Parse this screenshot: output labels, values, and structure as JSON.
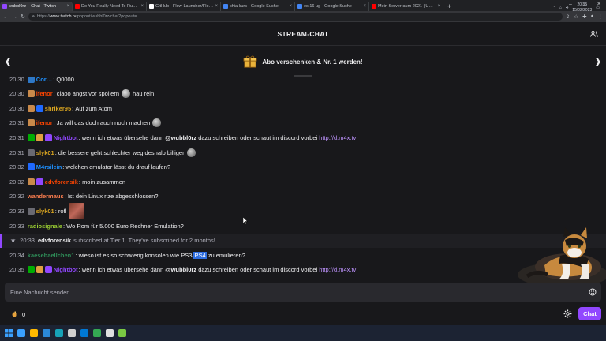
{
  "browser": {
    "tabs": [
      {
        "label": "wubbl0rz – Chat - Twitch",
        "active": true,
        "color": "#9147ff"
      },
      {
        "label": "Do You Really Need To Run Win…",
        "active": false,
        "color": "#ff0000"
      },
      {
        "label": "GitHub - Flow-Launcher/Flow.L…",
        "active": false,
        "color": "#ffffff"
      },
      {
        "label": "chia kurs - Google Suche",
        "active": false,
        "color": "#4285f4"
      },
      {
        "label": "es 16 ug - Google Suche",
        "active": false,
        "color": "#4285f4"
      },
      {
        "label": "Mein Serverraum 2021 | Umbau…",
        "active": false,
        "color": "#ff0000"
      }
    ],
    "url_prefix": "https://",
    "url_host": "www.twitch.tv",
    "url_path": "/popout/wubbl0rz/chat?popout="
  },
  "header": {
    "title": "STREAM-CHAT"
  },
  "banner": {
    "text": "Abo verschenken & Nr. 1 werden!"
  },
  "messages": [
    {
      "time": "20:30",
      "user": "Cor…",
      "user_color": "#1e90ff",
      "badges": [
        "#2e78c7"
      ],
      "parts": [
        {
          "t": "text",
          "v": "Q0000"
        }
      ]
    },
    {
      "time": "20:30",
      "user": "ifenor",
      "user_color": "#ff4500",
      "badges": [
        "#c98a4b"
      ],
      "parts": [
        {
          "t": "text",
          "v": "ciaoo angst vor spoilern"
        },
        {
          "t": "emote",
          "c": "#e8e8e8"
        },
        {
          "t": "text",
          "v": "hau rein"
        }
      ]
    },
    {
      "time": "20:30",
      "user": "shriker95",
      "user_color": "#daa520",
      "badges": [
        "#c98a4b",
        "#1f69ff"
      ],
      "parts": [
        {
          "t": "text",
          "v": "Auf zum Atom"
        }
      ]
    },
    {
      "time": "20:31",
      "user": "ifenor",
      "user_color": "#ff4500",
      "badges": [
        "#c98a4b"
      ],
      "parts": [
        {
          "t": "text",
          "v": "Ja will das doch auch noch machen"
        },
        {
          "t": "emote",
          "c": "#d8d8d8"
        }
      ]
    },
    {
      "time": "20:31",
      "user": "Nightbot",
      "user_color": "#9147ff",
      "badges": [
        "#00ad03",
        "#e0a040",
        "#9147ff"
      ],
      "parts": [
        {
          "t": "text",
          "v": "wenn ich etwas übersehe dann "
        },
        {
          "t": "mention",
          "v": "@wubbl0rz"
        },
        {
          "t": "text",
          "v": " dazu schreiben oder schaut im discord vorbei "
        },
        {
          "t": "link",
          "v": "http://d.m4x.tv"
        }
      ]
    },
    {
      "time": "20:31",
      "user": "slyk01",
      "user_color": "#daa520",
      "badges": [
        "#6a6a72"
      ],
      "parts": [
        {
          "t": "text",
          "v": "die bessere geht schlechter weg deshalb billiger"
        },
        {
          "t": "emote",
          "c": "#cfcfcf"
        }
      ]
    },
    {
      "time": "20:32",
      "user": "M4rsilein",
      "user_color": "#1e90ff",
      "badges": [
        "#1f69ff"
      ],
      "parts": [
        {
          "t": "text",
          "v": "welchen emulator lässt du drauf laufen?"
        }
      ]
    },
    {
      "time": "20:32",
      "user": "edvforensik",
      "user_color": "#ff4500",
      "badges": [
        "#c98a4b",
        "#9147ff"
      ],
      "parts": [
        {
          "t": "text",
          "v": "moin zusammen"
        }
      ]
    },
    {
      "time": "20:32",
      "user": "wandermaus",
      "user_color": "#ff7f50",
      "badges": [],
      "parts": [
        {
          "t": "text",
          "v": "Ist dein Linux rize abgeschlossen?"
        }
      ]
    },
    {
      "time": "20:33",
      "user": "slyk01",
      "user_color": "#daa520",
      "badges": [
        "#6a6a72"
      ],
      "parts": [
        {
          "t": "text",
          "v": "rofl"
        },
        {
          "t": "bigemote"
        }
      ]
    },
    {
      "time": "20:33",
      "user": "radiosignale",
      "user_color": "#9acd32",
      "badges": [],
      "parts": [
        {
          "t": "text",
          "v": "Wo Rom für 5.000 Euro Rechner Emulation?"
        }
      ]
    },
    {
      "time": "20:33",
      "user": "edvforensik",
      "user_color": "#efeff1",
      "sub": true,
      "parts": [
        {
          "t": "text",
          "v": "subscribed at Tier 1. They've subscribed for 2 months!"
        }
      ]
    },
    {
      "time": "20:34",
      "user": "kaesebaellchen1",
      "user_color": "#2e8b57",
      "badges": [],
      "parts": [
        {
          "t": "text",
          "v": "wieso ist es so schwierig konsolen wie PS3/"
        },
        {
          "t": "hl",
          "v": "PS4"
        },
        {
          "t": "text",
          "v": " zu emulieren?"
        }
      ]
    },
    {
      "time": "20:35",
      "user": "Nightbot",
      "user_color": "#9147ff",
      "badges": [
        "#00ad03",
        "#e0a040",
        "#9147ff"
      ],
      "parts": [
        {
          "t": "text",
          "v": "wenn ich etwas übersehe dann "
        },
        {
          "t": "mention",
          "v": "@wubbl0rz"
        },
        {
          "t": "text",
          "v": " dazu schreiben oder schaut im discord vorbei "
        },
        {
          "t": "link",
          "v": "http://d.m4x.tv"
        }
      ]
    }
  ],
  "input": {
    "placeholder": "Eine Nachricht senden"
  },
  "points": {
    "value": "0"
  },
  "chat_button": {
    "label": "Chat"
  },
  "taskbar": {
    "icons": [
      "#3aa0ff",
      "#ffb900",
      "#2b88d8",
      "#17a2b8",
      "#d0d0d0",
      "#0078d4",
      "#34a853",
      "#e0e0e0",
      "#7ac943"
    ],
    "time": "20:35",
    "date": "15/02/2023"
  },
  "colors": {
    "accent": "#9147ff",
    "background": "#18181b",
    "link": "#bf94ff"
  }
}
